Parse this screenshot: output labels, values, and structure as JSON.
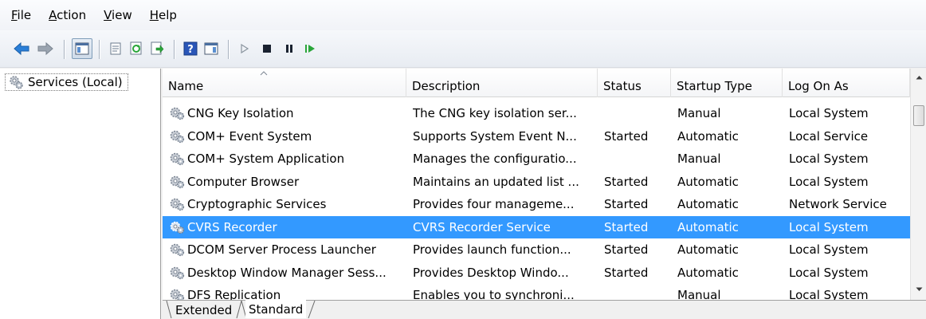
{
  "menubar": {
    "items": [
      {
        "first": "F",
        "rest": "ile"
      },
      {
        "first": "A",
        "rest": "ction"
      },
      {
        "first": "V",
        "rest": "iew"
      },
      {
        "first": "H",
        "rest": "elp"
      }
    ]
  },
  "toolbar": {
    "icons": [
      "back-arrow-icon",
      "forward-arrow-icon",
      "show-hide-console-tree-icon",
      "properties-icon",
      "refresh-icon",
      "export-list-icon",
      "help-icon",
      "show-hide-action-pane-icon",
      "start-service-icon",
      "stop-service-icon",
      "pause-service-icon",
      "restart-service-icon"
    ]
  },
  "tree": {
    "root_label": "Services (Local)"
  },
  "table": {
    "columns": [
      "Name",
      "Description",
      "Status",
      "Startup Type",
      "Log On As"
    ],
    "rows": [
      {
        "name": "CNG Key Isolation",
        "description": "The CNG key isolation ser...",
        "status": "",
        "startup": "Manual",
        "logon": "Local System"
      },
      {
        "name": "COM+ Event System",
        "description": "Supports System Event N...",
        "status": "Started",
        "startup": "Automatic",
        "logon": "Local Service"
      },
      {
        "name": "COM+ System Application",
        "description": "Manages the configuratio...",
        "status": "",
        "startup": "Manual",
        "logon": "Local System"
      },
      {
        "name": "Computer Browser",
        "description": "Maintains an updated list ...",
        "status": "Started",
        "startup": "Automatic",
        "logon": "Local System"
      },
      {
        "name": "Cryptographic Services",
        "description": "Provides four manageme...",
        "status": "Started",
        "startup": "Automatic",
        "logon": "Network Service"
      },
      {
        "name": "CVRS Recorder",
        "description": "CVRS Recorder Service",
        "status": "Started",
        "startup": "Automatic",
        "logon": "Local System"
      },
      {
        "name": "DCOM Server Process Launcher",
        "description": "Provides launch function...",
        "status": "Started",
        "startup": "Automatic",
        "logon": "Local System"
      },
      {
        "name": "Desktop Window Manager Sess...",
        "description": "Provides Desktop Windo...",
        "status": "Started",
        "startup": "Automatic",
        "logon": "Local System"
      },
      {
        "name": "DFS Replication",
        "description": "Enables you to synchroni...",
        "status": "",
        "startup": "Manual",
        "logon": "Local System"
      }
    ],
    "selected_row": "CVRS Recorder"
  },
  "tabs": {
    "items": [
      "Extended",
      "Standard"
    ],
    "active": "Standard"
  },
  "colors": {
    "selection": "#3399ff",
    "toolbar_icon_blue": "#1f7fd6",
    "play_green": "#2aa63a"
  }
}
